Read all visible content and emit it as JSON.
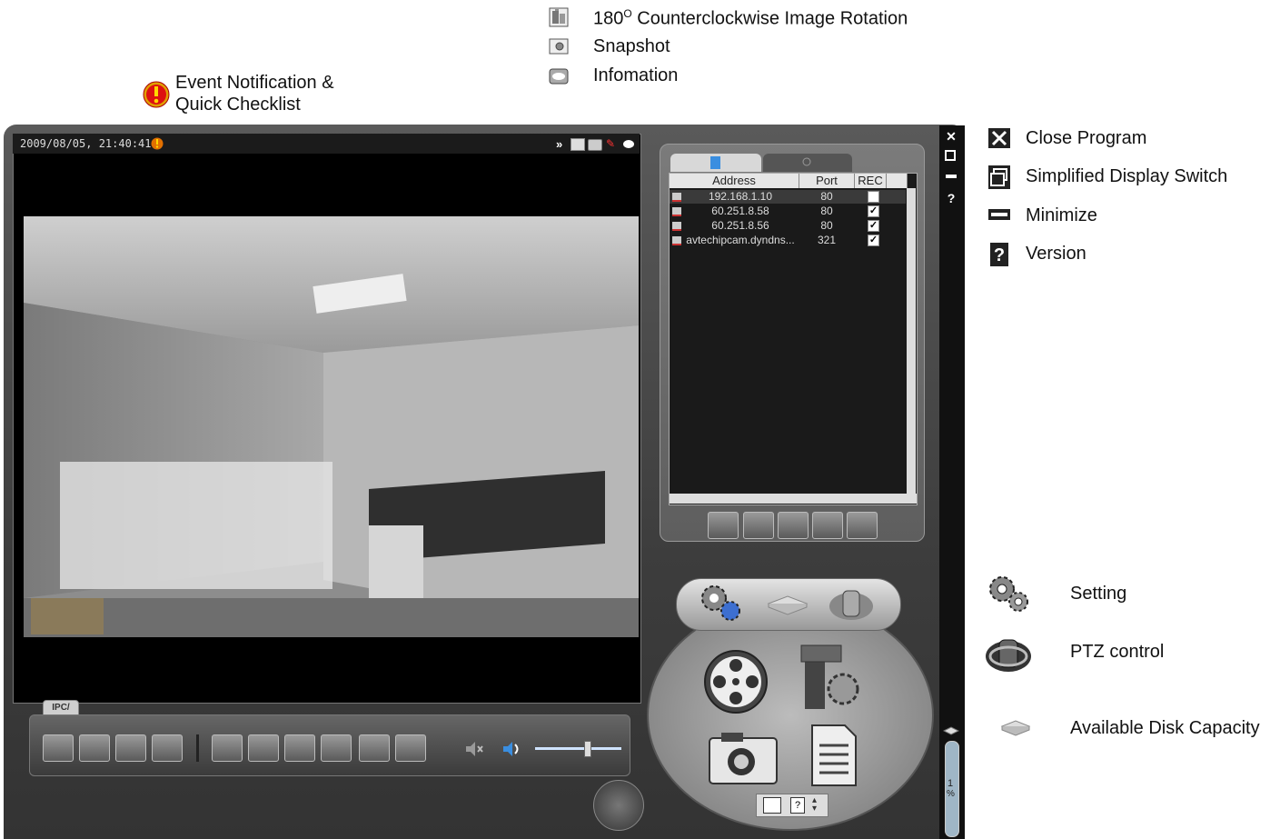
{
  "legend_top": {
    "rotation": {
      "label": "180",
      "sup": "O",
      "rest": " Counterclockwise Image Rotation"
    },
    "snapshot": "Snapshot",
    "information": "Infomation"
  },
  "legend_event": {
    "line1": "Event Notification &",
    "line2": "Quick Checklist"
  },
  "legend_right": {
    "close": "Close Program",
    "simplified": "Simplified Display Switch",
    "minimize": "Minimize",
    "version": "Version",
    "setting": "Setting",
    "ptz": "PTZ control",
    "disk": "Available Disk Capacity"
  },
  "video": {
    "timestamp": "2009/08/05, 21:40:41",
    "channel_label": "IPC/"
  },
  "address_table": {
    "headers": {
      "address": "Address",
      "port": "Port",
      "rec": "REC"
    },
    "rows": [
      {
        "address": "192.168.1.10",
        "port": "80",
        "rec": false
      },
      {
        "address": "60.251.8.58",
        "port": "80",
        "rec": true
      },
      {
        "address": "60.251.8.56",
        "port": "80",
        "rec": true
      },
      {
        "address": "avtechipcam.dyndns...",
        "port": "321",
        "rec": true
      }
    ]
  },
  "disk": {
    "percent": "1",
    "unit": "%"
  },
  "volume_level": 0.6
}
